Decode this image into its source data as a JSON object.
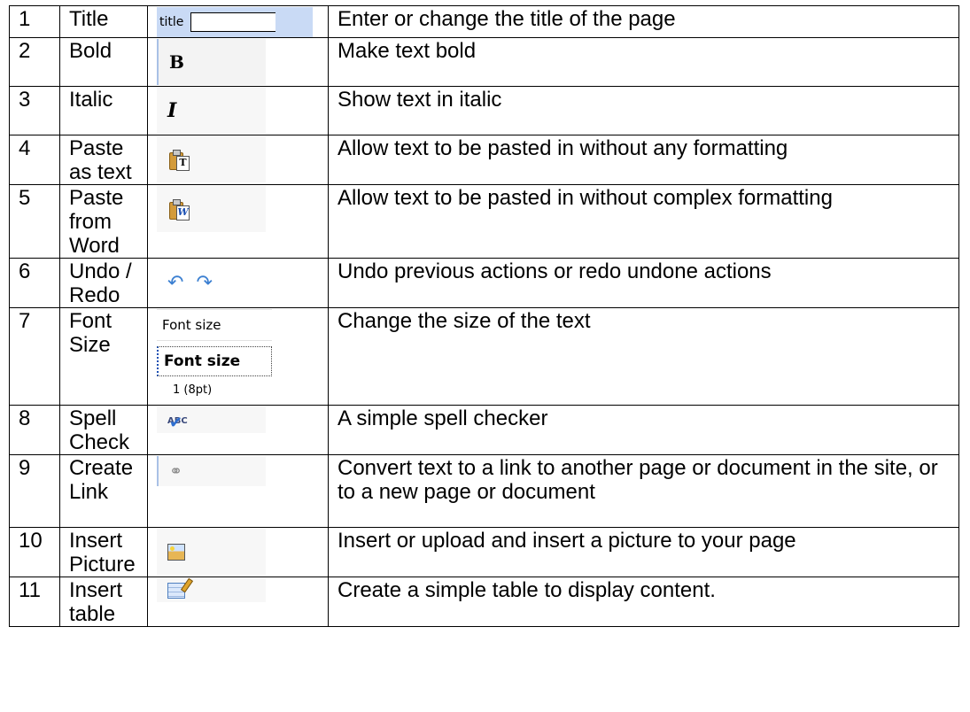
{
  "rows": [
    {
      "num": "1",
      "name": "Title",
      "icon": "title-field",
      "icon_text": "title",
      "desc": "Enter or change the title of the page"
    },
    {
      "num": "2",
      "name": "Bold",
      "icon": "bold-icon",
      "icon_text": "B",
      "desc": "Make text bold"
    },
    {
      "num": "3",
      "name": "Italic",
      "icon": "italic-icon",
      "icon_text": "I",
      "desc": "Show text in italic"
    },
    {
      "num": "4",
      "name": "Paste as text",
      "icon": "paste-text-icon",
      "icon_text": "T",
      "desc": "Allow text to be pasted in without any formatting"
    },
    {
      "num": "5",
      "name": "Paste from Word",
      "icon": "paste-word-icon",
      "icon_text": "W",
      "desc": "Allow text to be pasted in without complex formatting"
    },
    {
      "num": "6",
      "name": "Undo / Redo",
      "icon": "undo-redo-icon",
      "desc": "Undo previous actions or redo undone actions"
    },
    {
      "num": "7",
      "name": "Font Size",
      "icon": "font-size-dropdown",
      "icon_text_top": "Font size",
      "icon_text_selected": "Font size",
      "icon_text_option": "1 (8pt)",
      "desc": "Change the size of the text"
    },
    {
      "num": "8",
      "name": "Spell Check",
      "icon": "spell-check-icon",
      "icon_text": "ABC",
      "desc": "A simple spell checker"
    },
    {
      "num": "9",
      "name": "Create Link",
      "icon": "link-icon",
      "desc": "Convert text to a link to another page or document in the site, or to a new page or document"
    },
    {
      "num": "10",
      "name": "Insert Picture",
      "icon": "picture-icon",
      "desc": "Insert or upload and insert a picture to your page"
    },
    {
      "num": "11",
      "name": "Insert table",
      "icon": "table-icon",
      "desc": "Create a simple table to display content."
    }
  ]
}
